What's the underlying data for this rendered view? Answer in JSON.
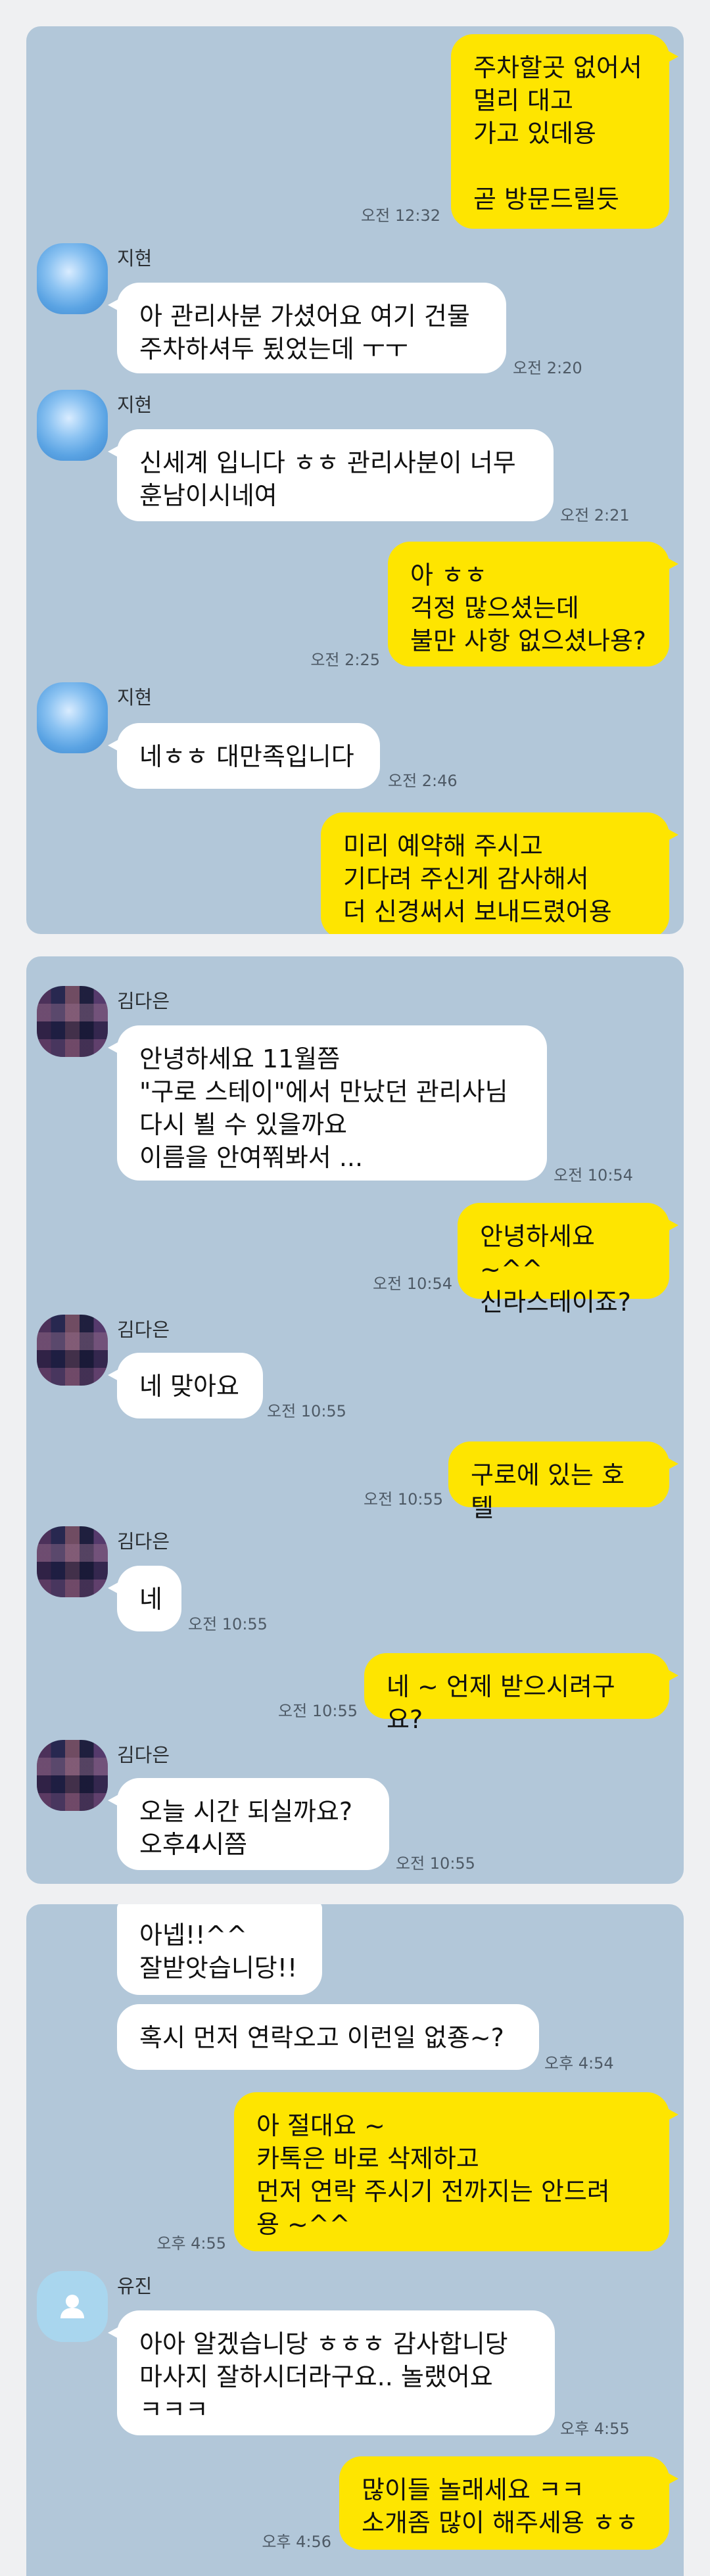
{
  "panel1": {
    "messages": [
      {
        "text": "주차할곳 없어서\n멀리 대고\n가고 있데용\n\n곧 방문드릴듯",
        "time": "오전 12:32"
      },
      {
        "sender": "지현",
        "text": "아 관리사분 가셨어요 여기 건물\n주차하셔두 됬었는데 ㅜㅜ",
        "time": "오전 2:20"
      },
      {
        "sender": "지현",
        "text": "신세계 입니다 ㅎㅎ 관리사분이 너무\n훈남이시네여",
        "time": "오전 2:21"
      },
      {
        "text": "아 ㅎㅎ\n걱정 많으셨는데\n불만 사항 없으셨나용?",
        "time": "오전 2:25"
      },
      {
        "sender": "지현",
        "text": "네ㅎㅎ 대만족입니다",
        "time": "오전 2:46"
      },
      {
        "text": "미리 예약해 주시고\n기다려 주신게 감사해서\n더 신경써서 보내드렸어용 ^^"
      }
    ]
  },
  "panel2": {
    "messages": [
      {
        "sender": "김다은",
        "text": "안녕하세요 11월쯤\n\"구로 스테이\"에서 만났던 관리사님\n다시 뵐 수 있을까요\n이름을 안여쭤봐서 ...",
        "time": "오전 10:54"
      },
      {
        "text": "안녕하세요 ~^^\n신라스테이죠?",
        "time": "오전 10:54"
      },
      {
        "sender": "김다은",
        "text": "네 맞아요",
        "time": "오전 10:55"
      },
      {
        "text": "구로에 있는 호텔",
        "time": "오전 10:55"
      },
      {
        "sender": "김다은",
        "text": "네",
        "time": "오전 10:55"
      },
      {
        "text": "네 ~ 언제 받으시려구요?",
        "time": "오전 10:55"
      },
      {
        "sender": "김다은",
        "text": "오늘  시간 되실까요?\n오후4시쯤",
        "time": "오전 10:55"
      }
    ]
  },
  "panel3": {
    "messages": [
      {
        "text": "아넵!!^^\n잘받앗습니당!!"
      },
      {
        "text": "혹시 먼저 연락오고 이런일 없죵~?",
        "time": "오후 4:54"
      },
      {
        "text": "아 절대요 ~\n카톡은 바로 삭제하고\n먼저 연락 주시기 전까지는 안드려\n용 ~^^",
        "time": "오후 4:55"
      },
      {
        "sender": "유진",
        "text": "아아 알겠습니당 ㅎㅎㅎ 감사합니당\n마사지 잘하시더라구요.. 놀랬어요\nㅋㅋㅋ",
        "time": "오후 4:55"
      },
      {
        "text": "많이들 놀래세요 ㅋㅋ\n소개좀 많이 해주세용 ㅎㅎ",
        "time": "오후 4:56"
      }
    ]
  }
}
